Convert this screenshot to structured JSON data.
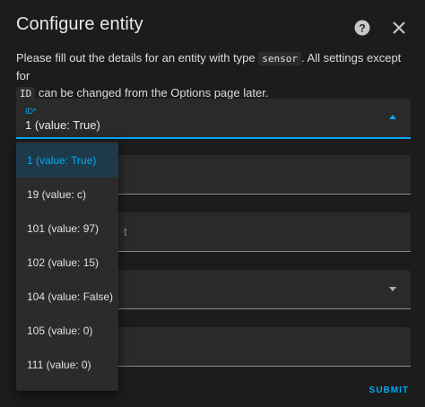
{
  "dialog": {
    "title": "Configure entity",
    "help_icon": "help-circle-icon",
    "close_icon": "close-icon",
    "description": {
      "part1": "Please fill out the details for an entity with type ",
      "type_code": "sensor",
      "part2": ". All settings except for ",
      "id_code": "ID",
      "part3": " can be changed from the Options page later."
    }
  },
  "id_field": {
    "label": "ID*",
    "value": "1 (value: True)"
  },
  "hidden_field_hint": "t",
  "submit_label": "SUBMIT",
  "dropdown": {
    "options": [
      "1 (value: True)",
      "19 (value: c)",
      "101 (value: 97)",
      "102 (value: 15)",
      "104 (value: False)",
      "105 (value: 0)",
      "111 (value: 0)"
    ],
    "selected_index": 0
  },
  "colors": {
    "accent": "#03a9f4",
    "background": "#1c1c1c",
    "field_bg": "#2a2a2a"
  }
}
